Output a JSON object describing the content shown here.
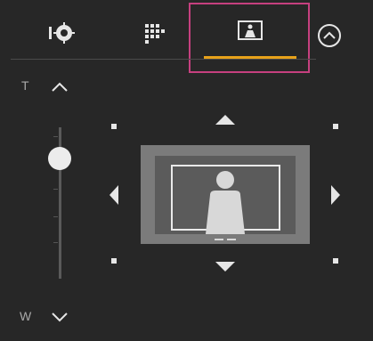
{
  "tabs": [
    {
      "icon": "camera-ring-icon",
      "state": "inactive"
    },
    {
      "icon": "grid-dots-icon",
      "state": "inactive"
    },
    {
      "icon": "person-frame-icon",
      "state": "active"
    }
  ],
  "colors": {
    "panel": "#272727",
    "active_underline": "#e7a21a",
    "highlight_frame": "#c6407f",
    "control": "#e6e6e6",
    "label": "#a9a9a9"
  },
  "zoom": {
    "tele_label": "T",
    "wide_label": "W",
    "level": 0.85
  },
  "controls": {
    "collapse_icon": "chevron-up-circle-icon",
    "pan_tilt_arrows": [
      "up",
      "down",
      "left",
      "right"
    ],
    "corner_markers": [
      "top-left",
      "top-right",
      "bottom-left",
      "bottom-right"
    ]
  }
}
